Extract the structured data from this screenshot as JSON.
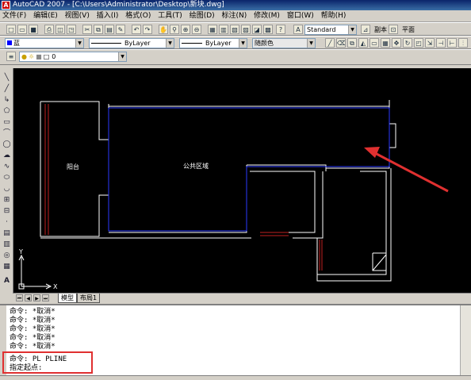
{
  "window": {
    "title": "AutoCAD 2007 - [C:\\Users\\Administrator\\Desktop\\新块.dwg]"
  },
  "menu": [
    "文件(F)",
    "编辑(E)",
    "视图(V)",
    "插入(I)",
    "格式(O)",
    "工具(T)",
    "绘图(D)",
    "标注(N)",
    "修改(M)",
    "窗口(W)",
    "帮助(H)"
  ],
  "toolbar_std": {
    "text_style": "Standard",
    "copy_label": "副本",
    "plane_label": "平面"
  },
  "toolbar_props": {
    "color": "蓝",
    "linetype": "ByLayer",
    "lineweight": "ByLayer",
    "plotstyle": "随颜色"
  },
  "toolbar_layers": {
    "layer": "0"
  },
  "drawing": {
    "labels": {
      "balcony": "阳台",
      "public_area": "公共区域"
    },
    "ucs": {
      "x": "X",
      "y": "Y"
    },
    "colors": {
      "canvas": "#000000",
      "walls": "#ffffff",
      "polyline": "#2a3aff",
      "arrow": "#e03030",
      "door": "#c02020"
    }
  },
  "tabs": [
    "模型",
    "布局1"
  ],
  "command": {
    "history": [
      "命令: *取消*",
      "命令: *取消*",
      "命令: *取消*",
      "命令: *取消*",
      "命令: *取消*"
    ],
    "current": "命令: PL PLINE",
    "prompt": "指定起点:"
  },
  "highlight_color": "#e03030"
}
